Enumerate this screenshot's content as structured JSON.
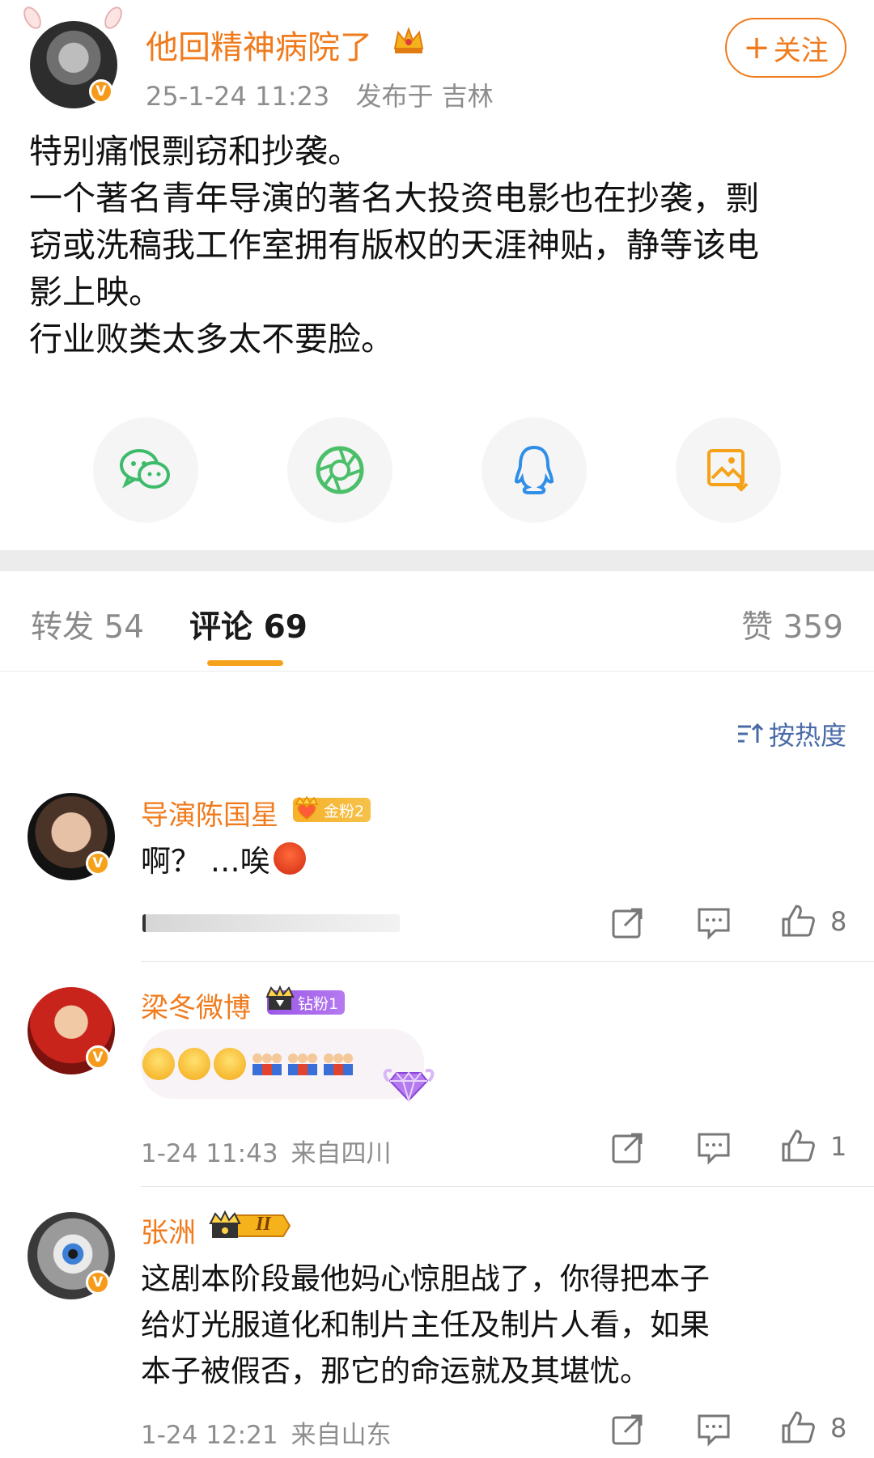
{
  "post": {
    "username": "他回精神病院了",
    "timestamp": "25-1-24 11:23",
    "location": "发布于 吉林",
    "follow_label": "关注",
    "follow_plus": "+",
    "body_lines": [
      "特别痛恨剽窃和抄袭。",
      "一个著名青年导演的著名大投资电影也在抄袭，剽",
      "窃或洗稿我工作室拥有版权的天涯神贴，静等该电",
      "影上映。",
      "行业败类太多太不要脸。"
    ],
    "verified_badge": "V"
  },
  "share": {
    "items": [
      "wechat-icon",
      "moments-icon",
      "qq-icon",
      "save-image-icon"
    ],
    "colors": {
      "wechat": "#3dbb6b",
      "moments": "#4bbf6a",
      "qq": "#2f8ee6",
      "save": "#f5a21a"
    }
  },
  "tabs": {
    "repost": "转发 54",
    "comments": "评论 69",
    "likes": "赞 359"
  },
  "sort": {
    "label": "按热度"
  },
  "comments": [
    {
      "name": "导演陈国星",
      "badge": "金粉2",
      "text": "啊？ …唉",
      "likes": "8"
    },
    {
      "name": "梁冬微博",
      "badge": "钻粉1",
      "time": "1-24 11:43",
      "location": "来自四川",
      "likes": "1"
    },
    {
      "name": "张洲",
      "badge": "II",
      "text_lines": [
        "这剧本阶段最他妈心惊胆战了，你得把本子",
        "给灯光服道化和制片主任及制片人看，如果",
        "本子被假否，那它的命运就及其堪忧。"
      ],
      "time": "1-24 12:21",
      "location": "来自山东",
      "likes": "8"
    }
  ],
  "colors": {
    "accent_orange": "#f07b1d",
    "link_blue": "#4a6ba8",
    "tab_underline": "#f5a21a",
    "gold_badge": "#f5a21a",
    "diamond_badge": "#a35de8"
  }
}
